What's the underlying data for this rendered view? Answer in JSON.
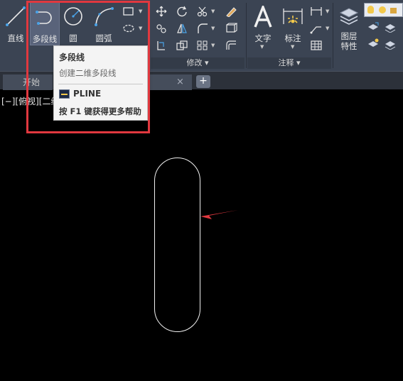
{
  "ribbon": {
    "draw_tools": {
      "line": "直线",
      "polyline": "多段线",
      "circle": "圆",
      "arc": "圆弧"
    },
    "modify_footer": "修改",
    "annotation": {
      "text": "文字",
      "dimension": "标注",
      "footer": "注释"
    },
    "layers": {
      "layer_properties": "图层\n特性"
    }
  },
  "tabs": {
    "start": "开始",
    "drawing_close": "×",
    "new": "+"
  },
  "viewport": {
    "label": "[−][俯视][二维"
  },
  "tooltip": {
    "title": "多段线",
    "description": "创建二维多段线",
    "command": "PLINE",
    "help": "按 F1 键获得更多帮助"
  },
  "colors": {
    "highlight": "#e1383f",
    "ribbon_bg": "#3b4453",
    "canvas_bg": "#000000",
    "shape_stroke": "#f0f0f0",
    "arrow": "#e1383f"
  }
}
